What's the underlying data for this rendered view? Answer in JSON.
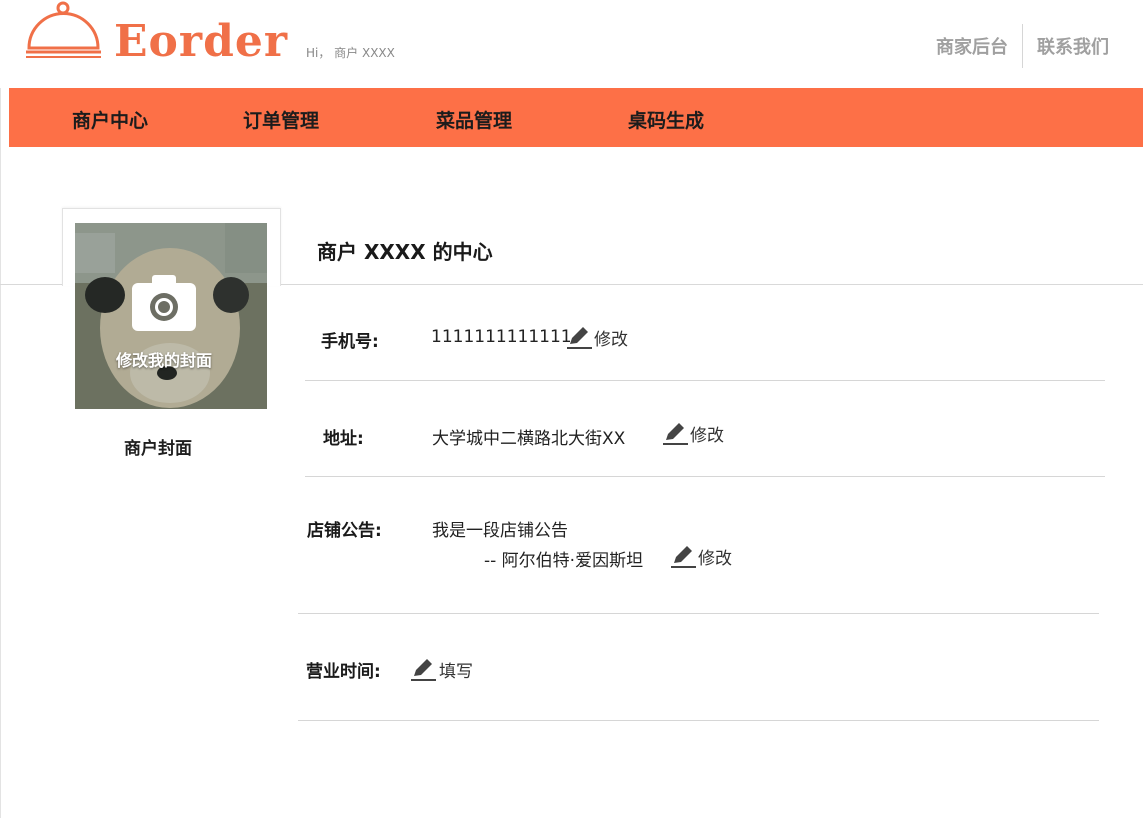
{
  "header": {
    "brand": "Eorder",
    "greeting": "Hi， 商户 XXXX",
    "links": [
      "商家后台",
      "联系我们"
    ]
  },
  "nav": {
    "items": [
      "商户中心",
      "订单管理",
      "菜品管理",
      "桌码生成"
    ]
  },
  "cover": {
    "caption": "修改我的封面",
    "label": "商户封面"
  },
  "center": {
    "title": "商户 XXXX 的中心"
  },
  "fields": {
    "phone": {
      "label": "手机号:",
      "value": "1111111111111",
      "action": "修改"
    },
    "address": {
      "label": "地址:",
      "value": "大学城中二横路北大街XX",
      "action": "修改"
    },
    "notice": {
      "label": "店铺公告:",
      "line1": "我是一段店铺公告",
      "line2": "-- 阿尔伯特·爱因斯坦",
      "action": "修改"
    },
    "hours": {
      "label": "营业时间:",
      "action": "填写"
    }
  },
  "colors": {
    "brand": "#f07048",
    "nav_bg": "#fd7047"
  },
  "icons": [
    "cloche-logo-icon",
    "camera-icon",
    "pencil-icon"
  ]
}
